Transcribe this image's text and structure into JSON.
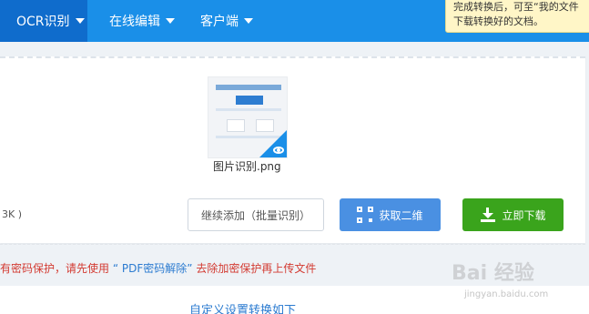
{
  "nav": {
    "items": [
      {
        "label": "OCR识别"
      },
      {
        "label": "在线编辑"
      },
      {
        "label": "客户端"
      }
    ]
  },
  "tooltip": {
    "line1": "完成转换后，可至“我的文件",
    "line2": "下载转换好的文档。"
  },
  "file": {
    "name": "图片识别.png",
    "size_fragment": "3K )"
  },
  "actions": {
    "continue_label": "继续添加（批量识别）",
    "qr_label": "获取二维",
    "download_label": "立即下载"
  },
  "warning": {
    "part1": "有密码保护，请先使用",
    "link": "“ PDF密码解除”",
    "part2": "去除加密保护再上传文件"
  },
  "footer": {
    "custom_settings_label": "自定义设置转换如下"
  },
  "watermark": {
    "main": "Bai 经验",
    "sub": "jingyan.baidu.com"
  },
  "colors": {
    "nav_bg": "#1a8fe8",
    "nav_active": "#0f6ccc",
    "qr_button": "#4a90e2",
    "download_button": "#3aa41c",
    "warning_red": "#d33a31",
    "link_blue": "#2b7bd0"
  }
}
